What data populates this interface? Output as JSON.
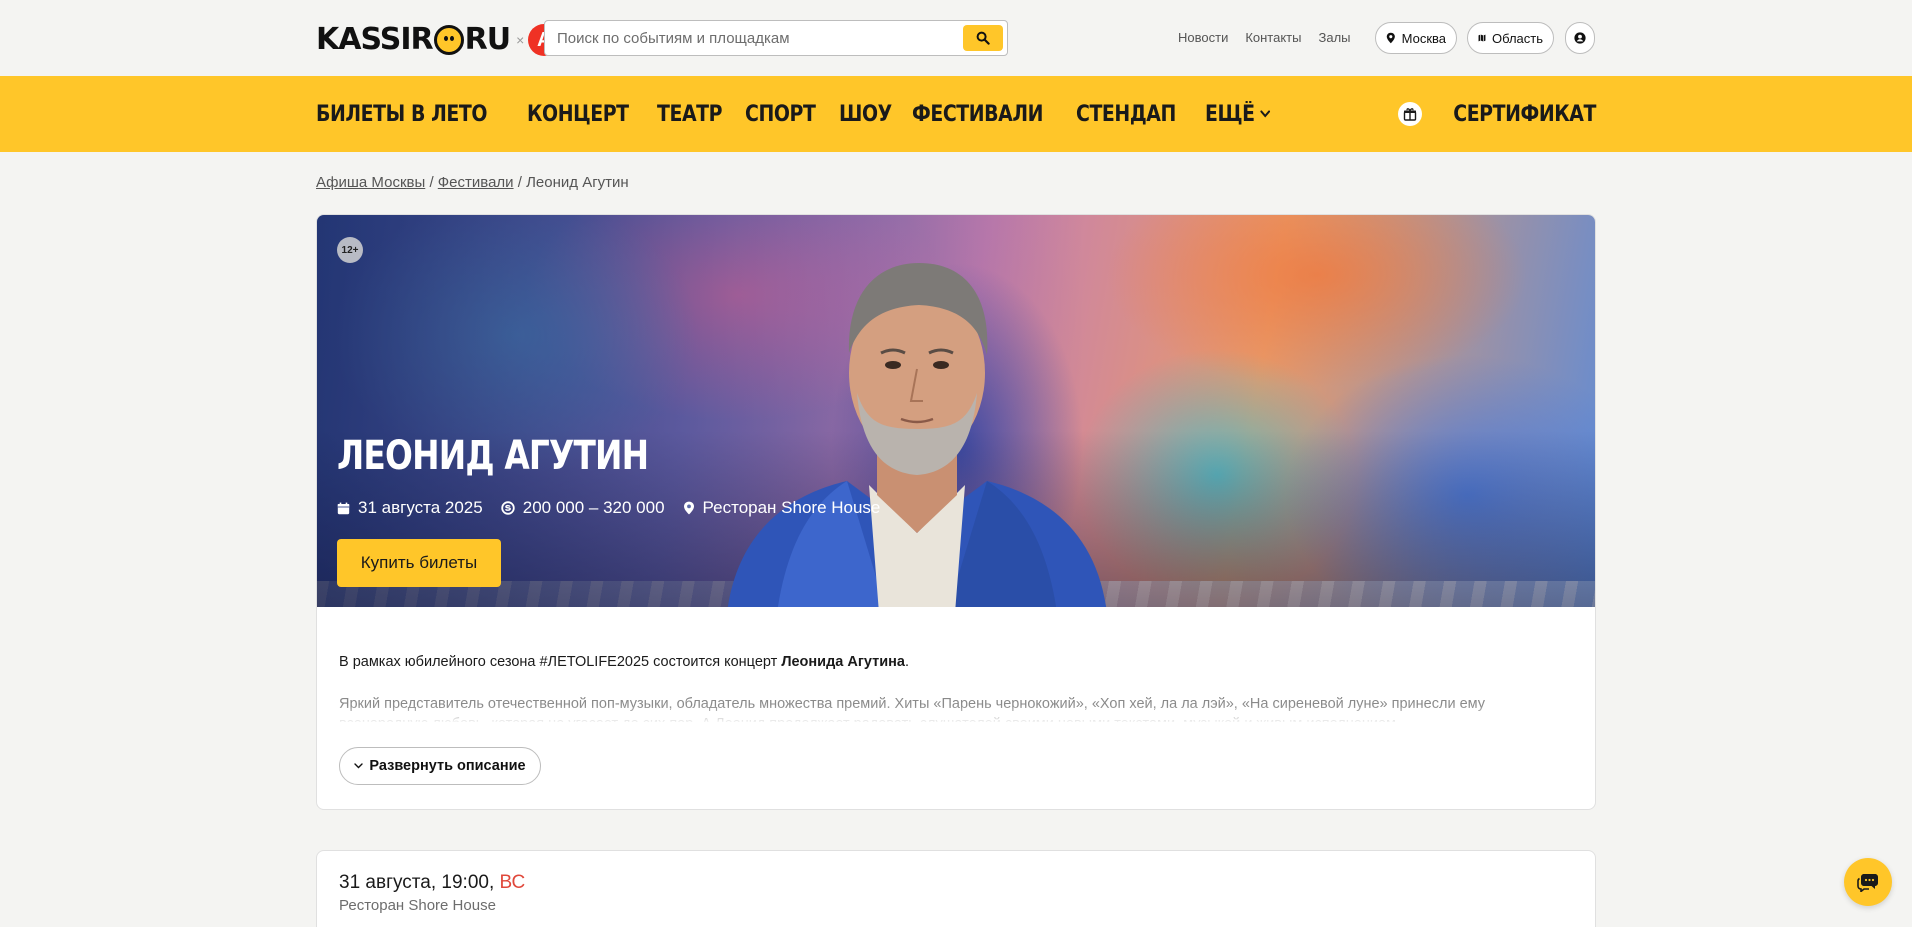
{
  "header": {
    "logo_text_left": "KASSIR",
    "logo_text_right": "RU",
    "logo_separator": "×",
    "logo_partner": "А",
    "search": {
      "placeholder": "Поиск по событиям и площадкам",
      "value": ""
    },
    "links": [
      "Новости",
      "Контакты",
      "Залы"
    ],
    "city_label": "Москва",
    "region_label": "Область"
  },
  "nav": {
    "items": [
      "БИЛЕТЫ В ЛЕТО",
      "КОНЦЕРТ",
      "ТЕАТР",
      "СПОРТ",
      "ШОУ",
      "ФЕСТИВАЛИ",
      "СТЕНДАП"
    ],
    "more_label": "ЕЩЁ",
    "certificate_label": "СЕРТИФИКАТ"
  },
  "breadcrumb": {
    "home": "Афиша Москвы",
    "separator": "/",
    "category": "Фестивали",
    "current": "Леонид Агутин"
  },
  "event": {
    "age_rating": "12+",
    "title": "ЛЕОНИД АГУТИН",
    "date": "31 августа 2025",
    "price": "200 000 – 320 000",
    "venue": "Ресторан Shore House",
    "buy_label": "Купить билеты",
    "description_intro": "В рамках юбилейного сезона #ЛЕТОLIFE2025 состоится концерт ",
    "description_name": "Леонида Агутина",
    "description_end": ".",
    "description_more": "Яркий представитель отечественной поп-музыки, обладатель множества премий. Хиты «Парень чернокожий», «Хоп хей, ла ла лэй», «На сиреневой луне» принесли ему всенародную любовь, которая не угасает до сих пор. А Леонид продолжает радовать слушателей своими новыми текстами, музыкой и живым исполнением.",
    "expand_label": "Развернуть описание"
  },
  "session": {
    "date_time": "31 августа, 19:00,",
    "weekday": "ВС",
    "venue": "Ресторан Shore House"
  },
  "colors": {
    "brand_yellow": "#ffc629",
    "weekday_red": "#e0483b",
    "partner_red": "#ef3124"
  },
  "icons": [
    "search-icon",
    "location-pin-icon",
    "map-icon",
    "user-icon",
    "chevron-down-icon",
    "gift-icon",
    "calendar-icon",
    "price-icon",
    "chat-icon"
  ]
}
